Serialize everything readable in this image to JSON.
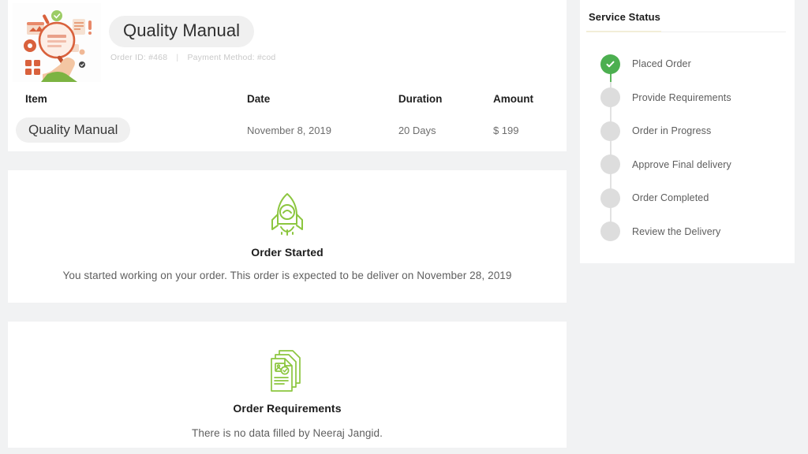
{
  "order": {
    "title": "Quality Manual",
    "order_id_label": "Order ID: #468",
    "payment_method_label": "Payment Method: #cod",
    "separator": "|",
    "thumbnail_icon": "quality-search-illustration"
  },
  "table": {
    "headers": {
      "item": "Item",
      "date": "Date",
      "duration": "Duration",
      "amount": "Amount"
    },
    "row": {
      "item": "Quality Manual",
      "date": "November 8, 2019",
      "duration": "20 Days",
      "amount": "$ 199"
    }
  },
  "order_started": {
    "icon": "rocket-check-icon",
    "title": "Order Started",
    "description": "You started working on your order. This order is expected to be deliver on November 28, 2019"
  },
  "order_requirements": {
    "icon": "documents-icon",
    "title": "Order Requirements",
    "description": "There is no data filled by Neeraj Jangid."
  },
  "service_status": {
    "heading": "Service Status",
    "steps": [
      {
        "label": "Placed Order",
        "done": true
      },
      {
        "label": "Provide Requirements",
        "done": false
      },
      {
        "label": "Order in Progress",
        "done": false
      },
      {
        "label": "Approve Final delivery",
        "done": false
      },
      {
        "label": "Order Completed",
        "done": false
      },
      {
        "label": "Review the Delivery",
        "done": false
      }
    ]
  },
  "colors": {
    "accent_green": "#4caf50",
    "icon_green": "#8cc63f",
    "page_background": "#f1f2f3",
    "card_background": "#ffffff",
    "pill_background": "#f0f0f0",
    "underline_cream": "#f2eed8"
  }
}
